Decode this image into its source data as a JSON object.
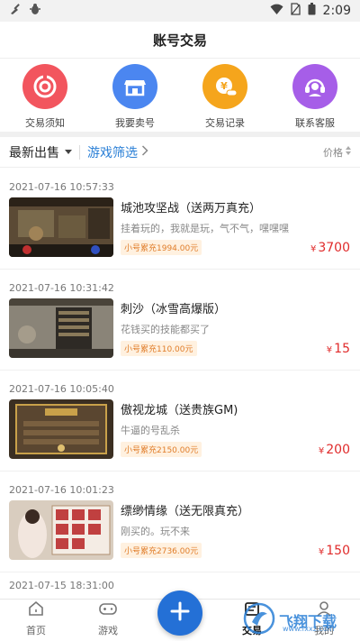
{
  "status": {
    "time": "2:09",
    "left_icons": [
      "broom-icon",
      "bug-icon"
    ],
    "right_icons": [
      "wifi-icon",
      "no-sim-icon",
      "battery-icon"
    ]
  },
  "header": {
    "title": "账号交易"
  },
  "shortcuts": [
    {
      "label": "交易须知",
      "icon": "target-icon",
      "color": "#f2555e"
    },
    {
      "label": "我要卖号",
      "icon": "store-icon",
      "color": "#4b86f0"
    },
    {
      "label": "交易记录",
      "icon": "coin-icon",
      "color": "#f5a51c"
    },
    {
      "label": "联系客服",
      "icon": "headset-icon",
      "color": "#a65ee8"
    }
  ],
  "filter": {
    "sort_label": "最新出售",
    "game_filter_label": "游戏筛选",
    "price_label": "价格"
  },
  "listings": [
    {
      "date": "2021-07-16 10:57:33",
      "name": "城池攻坚战（送两万真充）",
      "desc": "挂着玩的，我就是玩，气不气，嘿嘿嘿",
      "recharge": "小号累充1994.00元",
      "currency": "¥",
      "price": "3700",
      "thumb": "game-screenshot-1"
    },
    {
      "date": "2021-07-16 10:31:42",
      "name": "刺沙（冰雪高爆版）",
      "desc": "花钱买的技能都买了",
      "recharge": "小号累充110.00元",
      "currency": "¥",
      "price": "15",
      "thumb": "game-screenshot-2"
    },
    {
      "date": "2021-07-16 10:05:40",
      "name": "傲视龙城（送贵族GM)",
      "desc": "牛逼的号乱杀",
      "recharge": "小号累充2150.00元",
      "currency": "¥",
      "price": "200",
      "thumb": "game-screenshot-3"
    },
    {
      "date": "2021-07-16 10:01:23",
      "name": "缥缈情缘（送无限真充）",
      "desc": "刚买的。玩不来",
      "recharge": "小号累充2736.00元",
      "currency": "¥",
      "price": "150",
      "thumb": "game-screenshot-4"
    }
  ],
  "partial_listing_date": "2021-07-15 18:31:00",
  "bottom_nav": {
    "items": [
      {
        "label": "首页",
        "icon": "home-icon"
      },
      {
        "label": "游戏",
        "icon": "gamepad-icon"
      },
      {
        "label": "交易",
        "icon": "trade-icon",
        "active": true
      },
      {
        "label": "我的",
        "icon": "user-icon"
      }
    ],
    "fab_icon": "plus-icon"
  },
  "watermark": {
    "text": "飞翔下载",
    "url": "www.fxxz.com"
  }
}
